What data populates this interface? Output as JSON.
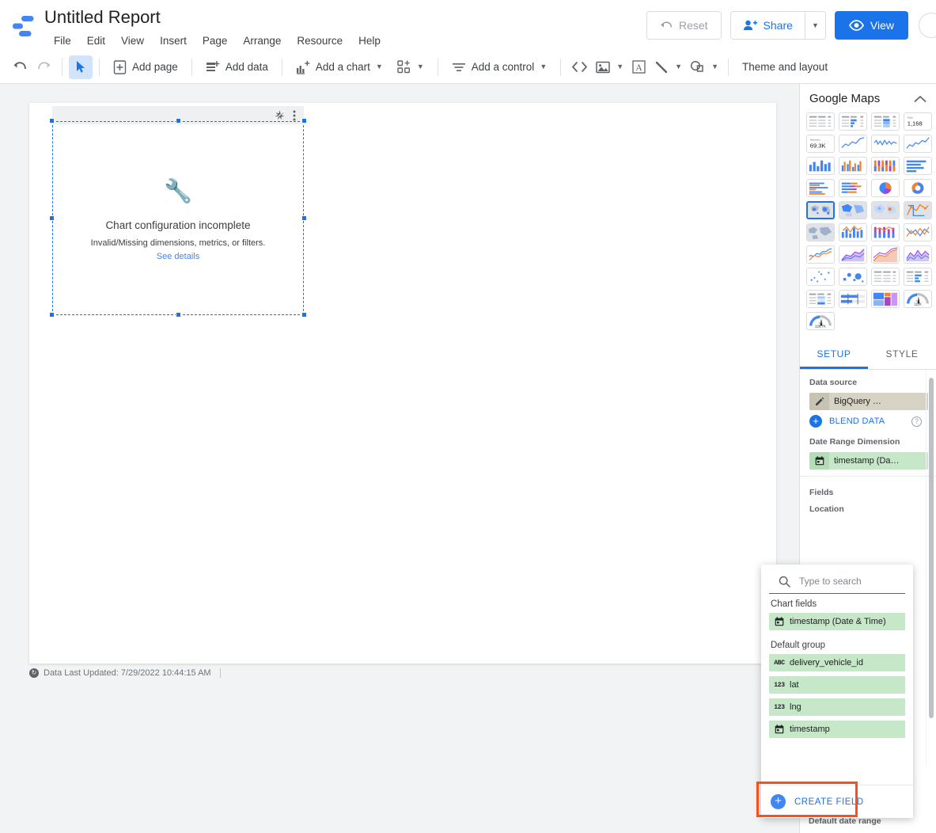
{
  "app": {
    "logo": "datastudio-logo",
    "title": "Untitled Report",
    "menus": [
      "File",
      "Edit",
      "View",
      "Insert",
      "Page",
      "Arrange",
      "Resource",
      "Help"
    ]
  },
  "header_actions": {
    "reset_label": "Reset",
    "reset_icon": "undo-arrow-icon",
    "share_label": "Share",
    "share_icon": "person-add-icon",
    "share_caret_icon": "chevron-down-icon",
    "view_label": "View",
    "view_icon": "eye-icon",
    "avatar": "user-avatar"
  },
  "toolbar": {
    "undo_icon": "undo-icon",
    "redo_icon": "redo-icon",
    "select_icon": "cursor-arrow-icon",
    "add_page_label": "Add page",
    "add_page_icon": "page-plus-icon",
    "add_data_label": "Add data",
    "add_data_icon": "database-plus-icon",
    "add_chart_label": "Add a chart",
    "add_chart_icon": "bar-chart-plus-icon",
    "community_viz_icon": "community-visualization-icon",
    "add_control_label": "Add a control",
    "add_control_icon": "filter-icon",
    "embed_icon": "code-brackets-icon",
    "image_icon": "image-icon",
    "text_icon": "text-box-icon",
    "line_icon": "line-icon",
    "shape_icon": "shape-icon",
    "theme_label": "Theme and layout"
  },
  "canvas": {
    "chart_element": {
      "header_icons": [
        "sparkle-wand-icon",
        "more-vert-icon"
      ],
      "placeholder_icon": "wrench-icon",
      "title": "Chart configuration incomplete",
      "subtitle": "Invalid/Missing dimensions, metrics, or filters.",
      "link": "See details"
    },
    "status": {
      "icon": "refresh-badge-icon",
      "text": "Data Last Updated: 7/29/2022 10:44:15 AM"
    }
  },
  "right_panel": {
    "title": "Google Maps",
    "collapse_icon": "chevron-up-icon",
    "chart_types": [
      {
        "name": "table",
        "kind": "table"
      },
      {
        "name": "table-with-bars",
        "kind": "table-bars"
      },
      {
        "name": "table-with-heatmap",
        "kind": "table-heat"
      },
      {
        "name": "scorecard",
        "kind": "scorecard",
        "label": "Total",
        "value": "1,168"
      },
      {
        "name": "scorecard-compact",
        "kind": "scorecard",
        "label": "Sessions",
        "value": "69.3K"
      },
      {
        "name": "time-series",
        "kind": "line"
      },
      {
        "name": "time-series-smooth",
        "kind": "line-dense"
      },
      {
        "name": "sparkline",
        "kind": "line2"
      },
      {
        "name": "column-chart",
        "kind": "bars"
      },
      {
        "name": "column-chart-grouped",
        "kind": "bars2"
      },
      {
        "name": "column-chart-stacked",
        "kind": "bars3"
      },
      {
        "name": "bar-chart",
        "kind": "hbars"
      },
      {
        "name": "bar-chart-grouped",
        "kind": "hbars2"
      },
      {
        "name": "bar-chart-stacked",
        "kind": "hbars3"
      },
      {
        "name": "pie-chart",
        "kind": "pie"
      },
      {
        "name": "donut-chart",
        "kind": "donut"
      },
      {
        "name": "google-maps-bubble",
        "kind": "map-bubble",
        "selected": true
      },
      {
        "name": "geo-chart",
        "kind": "map-filled"
      },
      {
        "name": "google-maps-heatmap",
        "kind": "map-heat"
      },
      {
        "name": "google-maps-lines",
        "kind": "map-lines"
      },
      {
        "name": "geo-chart-world",
        "kind": "map-world"
      },
      {
        "name": "combo-chart",
        "kind": "combo"
      },
      {
        "name": "combo-chart-stacked",
        "kind": "combo2"
      },
      {
        "name": "line-chart-multi",
        "kind": "line-multi"
      },
      {
        "name": "smoothed-line-chart",
        "kind": "line-smooth"
      },
      {
        "name": "area-chart",
        "kind": "area"
      },
      {
        "name": "stacked-area-chart",
        "kind": "area2"
      },
      {
        "name": "area-chart-multi",
        "kind": "area3"
      },
      {
        "name": "scatter-chart",
        "kind": "scatter"
      },
      {
        "name": "bubble-chart",
        "kind": "bubble"
      },
      {
        "name": "pivot-table",
        "kind": "pivot"
      },
      {
        "name": "pivot-table-bars",
        "kind": "pivot-bars"
      },
      {
        "name": "pivot-table-heatmap",
        "kind": "pivot-heat"
      },
      {
        "name": "bullet-chart",
        "kind": "bullet"
      },
      {
        "name": "treemap",
        "kind": "treemap"
      },
      {
        "name": "gauge",
        "kind": "gauge",
        "label": "Total",
        "value": "111K"
      },
      {
        "name": "gauge-alt",
        "kind": "gauge",
        "label": "Total",
        "value": "228.7K"
      }
    ],
    "tabs": [
      {
        "id": "setup",
        "label": "SETUP",
        "active": true
      },
      {
        "id": "style",
        "label": "STYLE",
        "active": false
      }
    ],
    "setup": {
      "data_source_label": "Data source",
      "data_source_value": "BigQuery …",
      "data_source_icon": "pencil-icon",
      "blend_label": "BLEND DATA",
      "blend_icon": "plus-circle-icon",
      "help_icon": "help-circle-icon",
      "date_range_label": "Date Range Dimension",
      "date_range_value": "timestamp (Da…",
      "date_range_icon": "calendar-icon",
      "fields_label": "Fields",
      "location_label": "Location",
      "default_date_range_label": "Default date range"
    }
  },
  "field_picker": {
    "search_placeholder": "Type to search",
    "search_value": "",
    "search_icon": "search-icon",
    "groups": [
      {
        "label": "Chart fields",
        "items": [
          {
            "name": "timestamp (Date & Time)",
            "type_icon": "calendar-icon"
          }
        ]
      },
      {
        "label": "Default group",
        "items": [
          {
            "name": "delivery_vehicle_id",
            "type_icon": "abc-icon"
          },
          {
            "name": "lat",
            "type_icon": "123-icon"
          },
          {
            "name": "lng",
            "type_icon": "123-icon"
          },
          {
            "name": "timestamp",
            "type_icon": "calendar-icon"
          }
        ]
      }
    ],
    "create_field_label": "CREATE FIELD",
    "create_field_icon": "plus-circle-icon"
  },
  "colors": {
    "accent_blue": "#1a73e8",
    "highlight_red": "#f4511e",
    "field_green": "#c6e7c8",
    "source_tan": "#d6d2c4",
    "canvas_gray": "#f1f3f4"
  }
}
